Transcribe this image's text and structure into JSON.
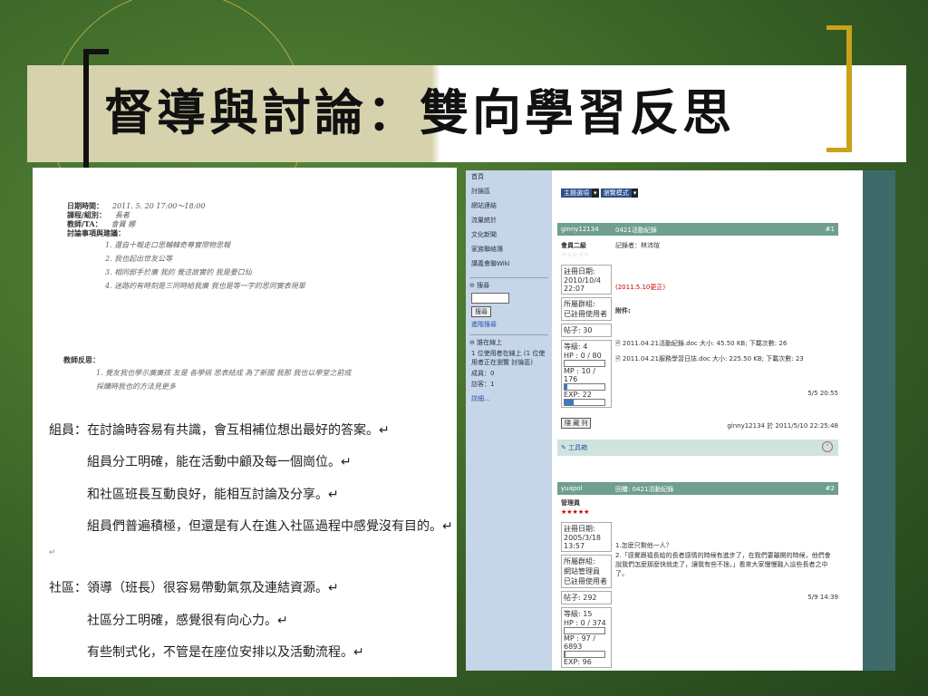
{
  "slide": {
    "title": "督導與討論：雙向學習反思",
    "colors": {
      "background": "#3f6a2a",
      "accent_gold": "#c9a21a",
      "title_band": "#d6d2ad"
    }
  },
  "document": {
    "form_fields": [
      {
        "label": "日期時間：",
        "handwriting": "2011. 5. 20      17:00～18:00"
      },
      {
        "label": "課程/組別：",
        "handwriting": "長者"
      },
      {
        "label": "教師/TA：",
        "handwriting": "會買 娜"
      },
      {
        "label": "討論事項與建議：",
        "handwriting": ""
      }
    ],
    "discussion_items": [
      "1. 還自十報走口思輔韓奇尊實際物思報",
      "2. 我也起出世友公等",
      "3. 相同部手於廣 我的 覺這故實的 我是要口仙",
      "4. 迷路的有時刻是三同時給我廣 我也是等一字的思同實表現單"
    ],
    "teacher_label": "教師反思：",
    "teacher_reflection": [
      "1. 覺友我也學示廣廣孩 友是 各學倘 思表結成 為了新國 我那 我也以學堂之前成",
      "    採購時我也的方法見更多"
    ],
    "typed_lines": [
      "組員：在討論時容易有共識，會互相補位想出最好的答案。↵",
      "組員分工明確，能在活動中顧及每一個崗位。↵",
      "和社區班長互動良好，能相互討論及分享。↵",
      "組員們普遍積極，但還是有人在進入社區過程中感覺沒有目的。↵",
      "↵",
      "社區：領導（班長）很容易帶動氣氛及連結資源。↵",
      "社區分工明確，感覺很有向心力。↵",
      "有些制式化，不管是在座位安排以及活動流程。↵"
    ]
  },
  "forum": {
    "sidebar_nav": [
      "首頁",
      "討論區",
      "網站連結",
      "流量統計",
      "文化新聞",
      "家族聯絡簿",
      "講義會聯Wiki"
    ],
    "search_label": "搜尋",
    "search_button": "搜尋",
    "advanced_search": "進階搜尋",
    "online_label": "誰在線上",
    "online_text": "1 位使用者在線上 (1 位使用者正在瀏覽 討論區)",
    "online_members": "成員：0",
    "online_guests": "訪客：1",
    "online_more": "詳細...",
    "view_select": "主題選項",
    "view_mode": "瀏覽模式",
    "post1": {
      "username": "ginny12134",
      "subject": "0421活動紀錄",
      "number": "#1",
      "rank": "會員二級",
      "recorder": "記錄者：林沛瑄",
      "reg_label": "註冊日期:",
      "reg_date": "2010/10/4",
      "reg_time": "22:07",
      "group_label": "所屬群組:",
      "group_value": "已註冊使用者",
      "posts": "帖子: 30",
      "level": "等級: 4",
      "hp": "HP : 0 / 80",
      "mp": "MP : 10 / 176",
      "exp": "EXP: 22",
      "mp_fill": 0.057,
      "exp_fill": 0.22,
      "edit_note": "(2011.5.10更正)",
      "attach_label": "附件:",
      "attachments": [
        "2011.04.21活動紀錄.doc 大小: 45.50 KB; 下載次數: 26",
        "2011.04.21服務學習日誌.doc 大小: 225.50 KB; 下載次數: 23"
      ],
      "date": "5/5 20:55",
      "hide_button": "隱 藏 列",
      "footer": "ginny12134 於 2011/5/10 22:25:48",
      "tools": "工具箱"
    },
    "post2": {
      "username": "yuapol",
      "subject": "回覆: 0421活動紀錄",
      "number": "#2",
      "rank": "管理員",
      "stars": "★★★★★",
      "reg_label": "註冊日期:",
      "reg_date": "2005/3/18",
      "reg_time": "13:57",
      "group_label": "所屬群組:",
      "group_value1": "網站管理員",
      "group_value2": "已註冊使用者",
      "posts": "帖子: 292",
      "level": "等級: 15",
      "hp": "HP : 0 / 374",
      "mp": "MP : 97 / 6893",
      "exp": "EXP: 96",
      "mp_fill": 0.014,
      "body1": "1.怎麼只剩他一人？",
      "body2": "2.「感覺跟福長給的長者感情的時候有進步了，在我們要離開的時候，他們會說我們怎麼那麼快就走了，讓我有些不捨。」看來大家慢慢融入這些長者之中了。",
      "date": "5/9 14:39"
    }
  }
}
